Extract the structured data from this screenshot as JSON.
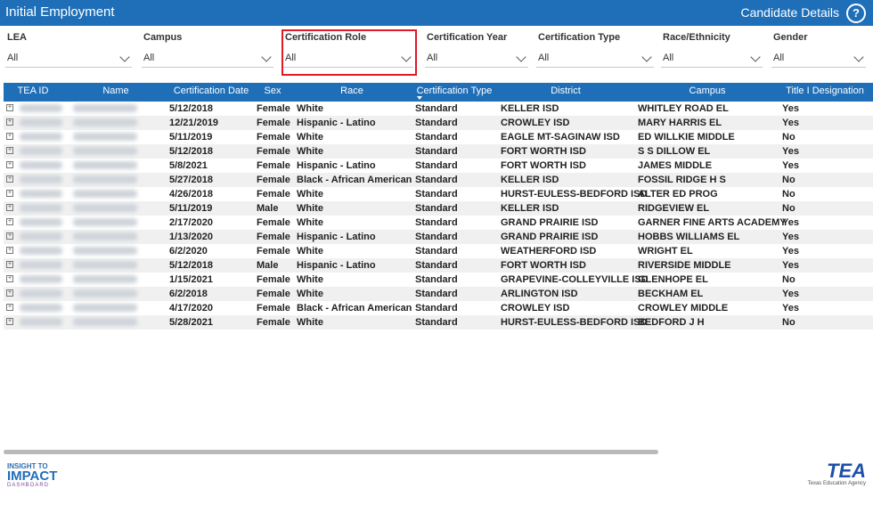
{
  "header": {
    "title": "Initial Employment",
    "details": "Candidate Details",
    "help": "?"
  },
  "filters": [
    {
      "label": "LEA",
      "value": "All"
    },
    {
      "label": "Campus",
      "value": "All"
    },
    {
      "label": "Certification Role",
      "value": "All"
    },
    {
      "label": "Certification Year",
      "value": "All"
    },
    {
      "label": "Certification Type",
      "value": "All"
    },
    {
      "label": "Race/Ethnicity",
      "value": "All"
    },
    {
      "label": "Gender",
      "value": "All"
    }
  ],
  "table": {
    "columns": [
      "TEA ID",
      "Name",
      "Certification Date",
      "Sex",
      "Race",
      "Certification Type",
      "District",
      "Campus",
      "Title I Designation"
    ],
    "rows": [
      [
        "5/12/2018",
        "Female",
        "White",
        "Standard",
        "KELLER ISD",
        "WHITLEY ROAD EL",
        "Yes"
      ],
      [
        "12/21/2019",
        "Female",
        "Hispanic - Latino",
        "Standard",
        "CROWLEY ISD",
        "MARY HARRIS EL",
        "Yes"
      ],
      [
        "5/11/2019",
        "Female",
        "White",
        "Standard",
        "EAGLE MT-SAGINAW ISD",
        "ED WILLKIE MIDDLE",
        "No"
      ],
      [
        "5/12/2018",
        "Female",
        "White",
        "Standard",
        "FORT WORTH ISD",
        "S S DILLOW EL",
        "Yes"
      ],
      [
        "5/8/2021",
        "Female",
        "Hispanic - Latino",
        "Standard",
        "FORT WORTH ISD",
        "JAMES MIDDLE",
        "Yes"
      ],
      [
        "5/27/2018",
        "Female",
        "Black - African American",
        "Standard",
        "KELLER ISD",
        "FOSSIL RIDGE H S",
        "No"
      ],
      [
        "4/26/2018",
        "Female",
        "White",
        "Standard",
        "HURST-EULESS-BEDFORD ISD",
        "ALTER ED PROG",
        "No"
      ],
      [
        "5/11/2019",
        "Male",
        "White",
        "Standard",
        "KELLER ISD",
        "RIDGEVIEW EL",
        "No"
      ],
      [
        "2/17/2020",
        "Female",
        "White",
        "Standard",
        "GRAND PRAIRIE ISD",
        "GARNER FINE ARTS ACADEMY",
        "Yes"
      ],
      [
        "1/13/2020",
        "Female",
        "Hispanic - Latino",
        "Standard",
        "GRAND PRAIRIE ISD",
        "HOBBS WILLIAMS EL",
        "Yes"
      ],
      [
        "6/2/2020",
        "Female",
        "White",
        "Standard",
        "WEATHERFORD ISD",
        "WRIGHT EL",
        "Yes"
      ],
      [
        "5/12/2018",
        "Male",
        "Hispanic - Latino",
        "Standard",
        "FORT WORTH ISD",
        "RIVERSIDE MIDDLE",
        "Yes"
      ],
      [
        "1/15/2021",
        "Female",
        "White",
        "Standard",
        "GRAPEVINE-COLLEYVILLE ISD",
        "GLENHOPE EL",
        "No"
      ],
      [
        "6/2/2018",
        "Female",
        "White",
        "Standard",
        "ARLINGTON ISD",
        "BECKHAM EL",
        "Yes"
      ],
      [
        "4/17/2020",
        "Female",
        "Black - African American",
        "Standard",
        "CROWLEY ISD",
        "CROWLEY MIDDLE",
        "Yes"
      ],
      [
        "5/28/2021",
        "Female",
        "White",
        "Standard",
        "HURST-EULESS-BEDFORD ISD",
        "BEDFORD J H",
        "No"
      ]
    ]
  },
  "logos": {
    "left": {
      "line1": "INSIGHT TO",
      "line2": "IMPACT",
      "line3": "DASHBOARD"
    },
    "right": {
      "line1": "TEA",
      "line2": "Texas Education Agency"
    }
  },
  "colors": {
    "header": "#1f6fb8",
    "highlight": "#e01b24"
  }
}
